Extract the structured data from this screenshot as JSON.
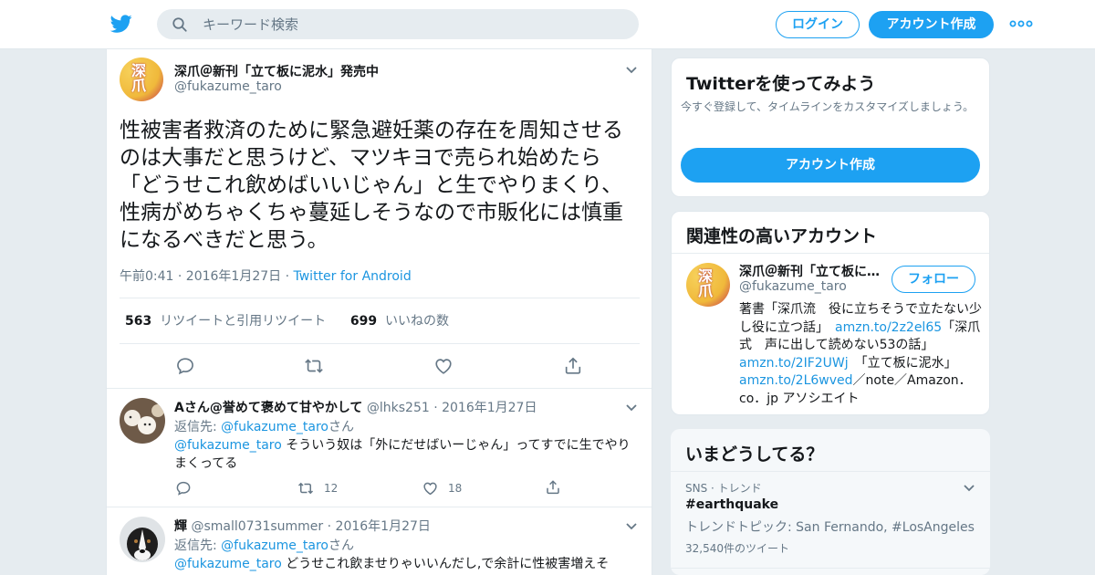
{
  "topbar": {
    "search_placeholder": "キーワード検索",
    "login_label": "ログイン",
    "signup_label": "アカウント作成"
  },
  "tweet": {
    "author_name": "深爪＠新刊「立て板に泥水」発売中",
    "author_handle": "@fukazume_taro",
    "avatar_text": "深爪",
    "text": "性被害者救済のために緊急避妊薬の存在を周知させるのは大事だと思うけど、マツキヨで売られ始めたら「どうせこれ飲めばいいじゃん」と生でやりまくり、性病がめちゃくちゃ蔓延しそうなので市販化には慎重になるべきだと思う。",
    "time": "午前0:41 · 2016年1月27日 · ",
    "source": "Twitter for Android",
    "retweet_count": "563",
    "retweet_label": "リツイートと引用リツイート",
    "like_count": "699",
    "like_label": "いいねの数"
  },
  "replies": [
    {
      "name": "Aさん@誉めて褒めて甘やかして",
      "meta": " @lhks251 · 2016年1月27日",
      "replyto_prefix": "返信先: ",
      "replyto_handle": "@fukazume_taro",
      "replyto_suffix": "さん",
      "mention": "@fukazume_taro",
      "text": " そういう奴は「外にだせばいーじゃん」ってすでに生でやりまくってる",
      "retweets": "12",
      "likes": "18"
    },
    {
      "name": "輝",
      "meta": " @small0731summer · 2016年1月27日",
      "replyto_prefix": "返信先: ",
      "replyto_handle": "@fukazume_taro",
      "replyto_suffix": "さん",
      "mention": "@fukazume_taro",
      "text": " どうせこれ飲ませりゃいいんだし,で余計に性被害増えそ"
    }
  ],
  "signup_card": {
    "title": "Twitterを使ってみよう",
    "subtitle": "今すぐ登録して、タイムラインをカスタマイズしましょう。",
    "button": "アカウント作成"
  },
  "related": {
    "title": "関連性の高いアカウント",
    "name": "深爪＠新刊「立て板に泥水」発売中",
    "handle": "@fukazume_taro",
    "follow_label": "フォロー",
    "bio_1": "著書「深爪流　役に立ちそうで立たない少し役に立つ話」　",
    "bio_link_1": "amzn.to/2z2el65",
    "bio_2": "「深爪式　声に出して読めない53の話」",
    "bio_link_2": "amzn.to/2IF2UWj",
    "bio_3": "　「立て板に泥水」",
    "bio_link_3": "amzn.to/2L6wved",
    "bio_4": "／note／Amazon．co．jp アソシエイト"
  },
  "trends": {
    "title": "いまどうしてる？",
    "meta": "SNS · トレンド",
    "name": "#earthquake",
    "desc": "トレンドトピック: San Fernando, #LosAngeles",
    "count": "32,540件のツイート"
  },
  "colors": {
    "accent": "#1da1f2",
    "link": "#1b95e0",
    "muted": "#657786",
    "background": "#e6ecf0"
  }
}
